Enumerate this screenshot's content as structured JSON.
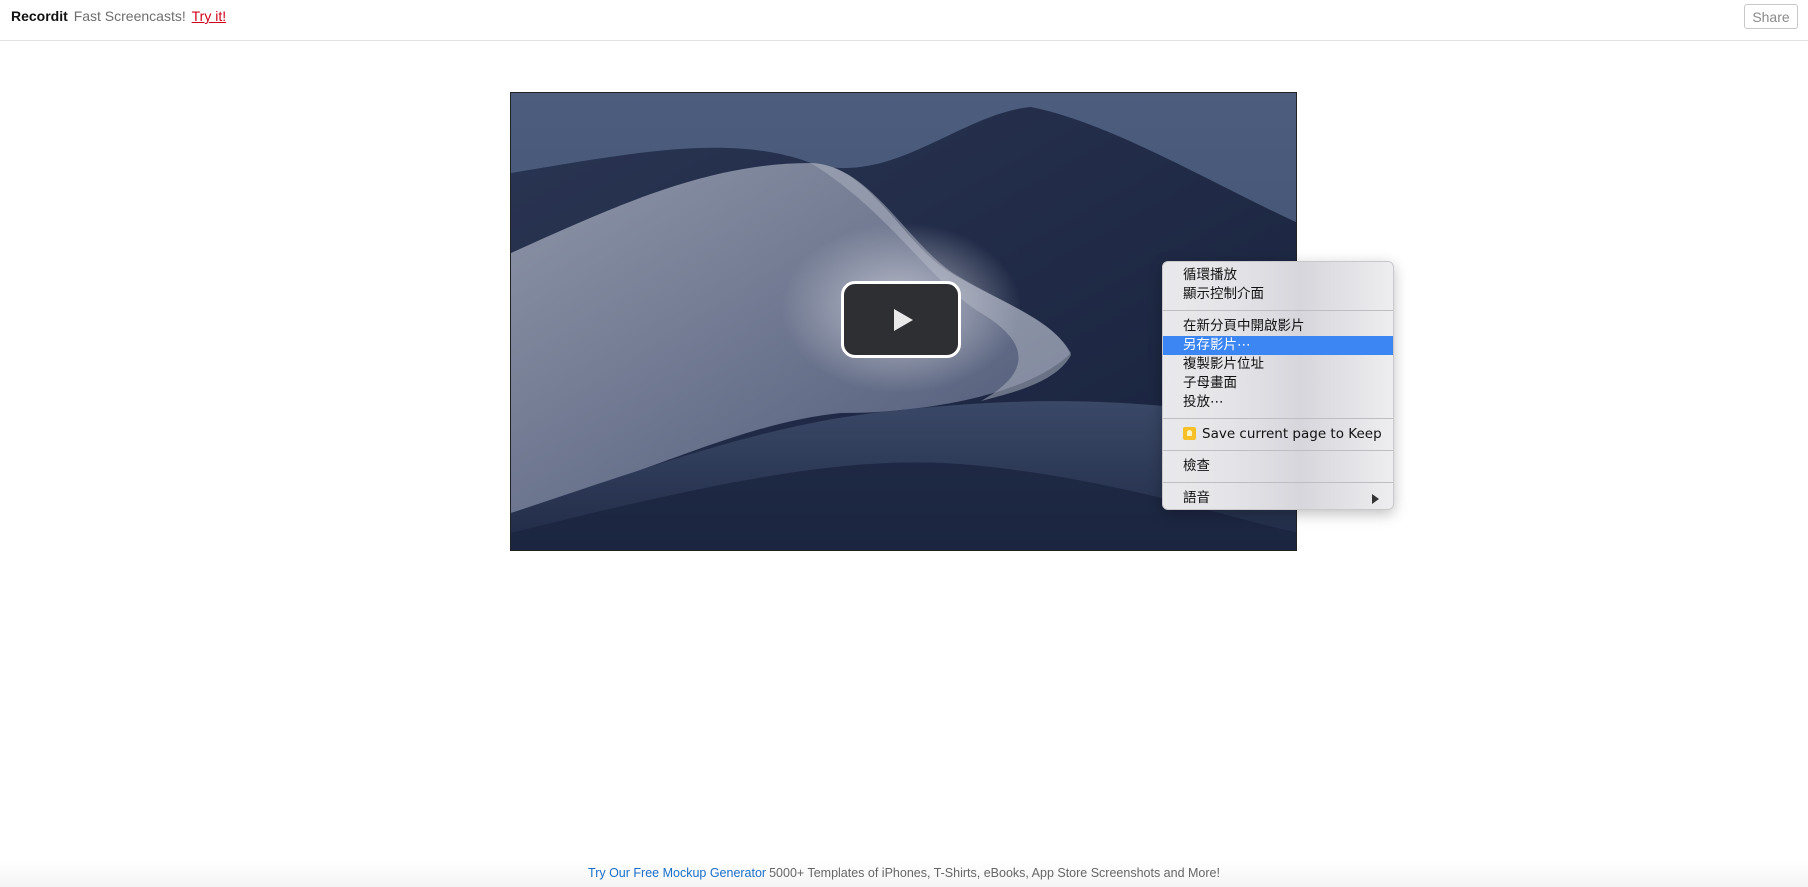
{
  "header": {
    "brand": "Recordit",
    "tagline": "Fast Screencasts!",
    "try_link": "Try it!",
    "share_label": "Share"
  },
  "video": {
    "play_icon": "play-icon"
  },
  "context_menu": {
    "items": [
      {
        "label": "循環播放"
      },
      {
        "label": "顯示控制介面"
      },
      {
        "label": "在新分頁中開啟影片"
      },
      {
        "label": "另存影片⋯",
        "highlighted": true
      },
      {
        "label": "複製影片位址"
      },
      {
        "label": "子母畫面"
      },
      {
        "label": "投放⋯"
      },
      {
        "label": "Save current page to Keep",
        "icon": "keep-icon"
      },
      {
        "label": "檢查"
      },
      {
        "label": "語音",
        "submenu": true
      }
    ],
    "highlight_color": "#3c86f3"
  },
  "footer": {
    "link": "Try Our Free Mockup Generator",
    "text": "5000+ Templates of iPhones, T-Shirts, eBooks, App Store Screenshots and More!"
  }
}
